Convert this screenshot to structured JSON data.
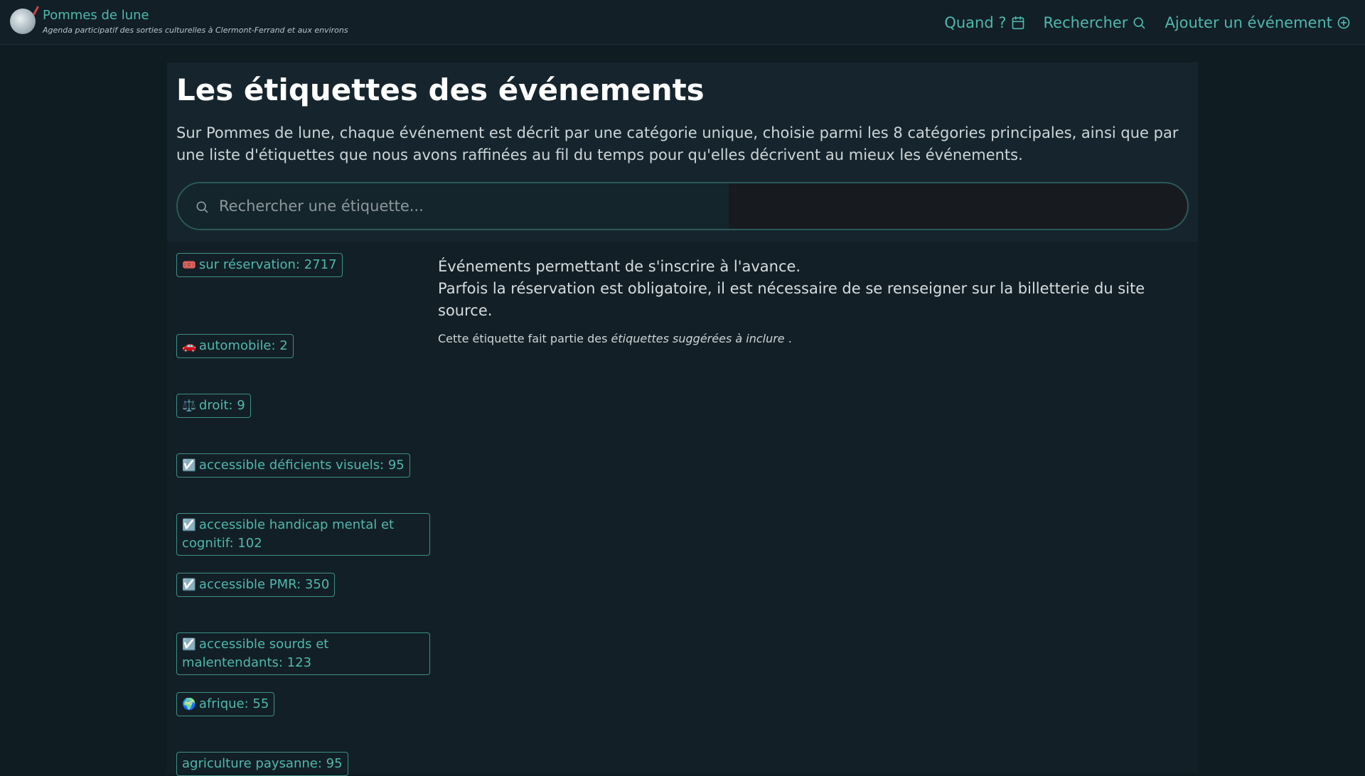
{
  "header": {
    "brand_name": "Pommes de lune",
    "tagline": "Agenda participatif des sorties culturelles à Clermont-Ferrand et aux environs",
    "nav": [
      {
        "label": "Quand ?",
        "icon": "calendar-icon"
      },
      {
        "label": "Rechercher",
        "icon": "search-icon"
      },
      {
        "label": "Ajouter un événement",
        "icon": "plus-circle-icon"
      }
    ]
  },
  "page": {
    "title": "Les étiquettes des événements",
    "description": "Sur Pommes de lune, chaque événement est décrit par une catégorie unique, choisie parmi les 8 catégories principales, ainsi que par une liste d'étiquettes que nous avons raffinées au fil du temps pour qu'elles décrivent au mieux les événements.",
    "search_placeholder": "Rechercher une étiquette..."
  },
  "tags": [
    {
      "emoji": "🎟️",
      "label": "sur réservation: 2717"
    },
    {
      "emoji": "🚗",
      "label": "automobile: 2"
    },
    {
      "emoji": "⚖️",
      "label": "droit: 9"
    },
    {
      "emoji": "☑️",
      "label": "accessible déficients visuels: 95"
    },
    {
      "emoji": "☑️",
      "label": "accessible handicap mental et cognitif: 102"
    },
    {
      "emoji": "☑️",
      "label": "accessible PMR: 350"
    },
    {
      "emoji": "☑️",
      "label": "accessible sourds et malentendants: 123"
    },
    {
      "emoji": "🌍",
      "label": "afrique: 55"
    },
    {
      "emoji": "",
      "label": "agriculture paysanne: 95"
    }
  ],
  "details": {
    "line1": "Événements permettant de s'inscrire à l'avance.",
    "line2": "Parfois la réservation est obligatoire, il est nécessaire de se renseigner sur la billetterie du site source.",
    "note_prefix": "Cette étiquette fait partie des",
    "note_em": "étiquettes suggérées à inclure",
    "note_suffix": "."
  },
  "colors": {
    "accent": "#4fb8ad",
    "background": "#0f1c22",
    "card": "#131f26"
  }
}
